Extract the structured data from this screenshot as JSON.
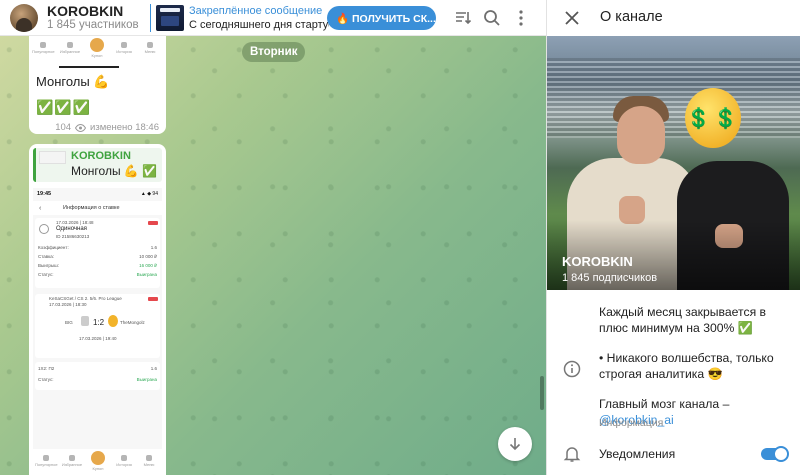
{
  "header": {
    "channel_title": "KOROBKIN",
    "channel_subtitle": "1 845 участников",
    "pinned_title": "Закреплённое сообщение",
    "pinned_text": "С сегодняшнего дня стартуе...",
    "pinned_button": "🔥 ПОЛУЧИТЬ СК...",
    "icons": [
      "sort-icon",
      "search-icon",
      "more-vert-icon"
    ]
  },
  "chat": {
    "date_label": "Вторник",
    "message1": {
      "tabs": [
        "Популярное",
        "Избранное",
        "Купон",
        "История",
        "Меню"
      ],
      "text": "Монголы 💪",
      "checks": "✅✅✅",
      "views": "104",
      "edited": "изменено 18:46"
    },
    "message2": {
      "reply_name": "KOROBKIN",
      "reply_text": "Монголы 💪 ✅",
      "shot": {
        "time": "19:45",
        "status_right": "▲ ◆ 94",
        "screen_title": "Информация о ставке",
        "bet_date": "17.03.2026 | 18:48",
        "bet_type": "Одиночная",
        "bet_id": "ID 21586630213",
        "rows": [
          {
            "label": "Коэффициент:",
            "value": "1.6"
          },
          {
            "label": "Ставка:",
            "value": "10 000 ₽"
          },
          {
            "label": "Выигрыш:",
            "value": "16 000 ₽"
          },
          {
            "label": "Статус:",
            "value": "Выиграна"
          }
        ],
        "league": "KeSaCSGet / CS 2. 5/6. Pro League",
        "match_date": "17.03.2026 | 18:30",
        "team1": "BIG",
        "score": "1:2",
        "team2": "TheMongolz",
        "finished": "17.03.2026 | 19:40",
        "market": "1X2: П2",
        "market_value": "1.6",
        "status_label": "Статус:",
        "status_value": "Выиграна",
        "tabs": [
          "Популярное",
          "Избранное",
          "Купон",
          "История",
          "Меню"
        ]
      }
    }
  },
  "panel": {
    "title": "О канале",
    "channel_name": "KOROBKIN",
    "subscribers": "1 845 подписчиков",
    "emoji_overlay": "💲💲",
    "description_p1": "Каждый месяц закрывается в плюс минимум на 300% ✅",
    "description_p2": "• Никакого волшебства, только строгая аналитика 😎",
    "description_p3a": "Главный мозг канала –",
    "description_link": "@korobkin_ai",
    "description_label": "Информация",
    "notifications_label": "Уведомления",
    "notifications_on": true
  }
}
